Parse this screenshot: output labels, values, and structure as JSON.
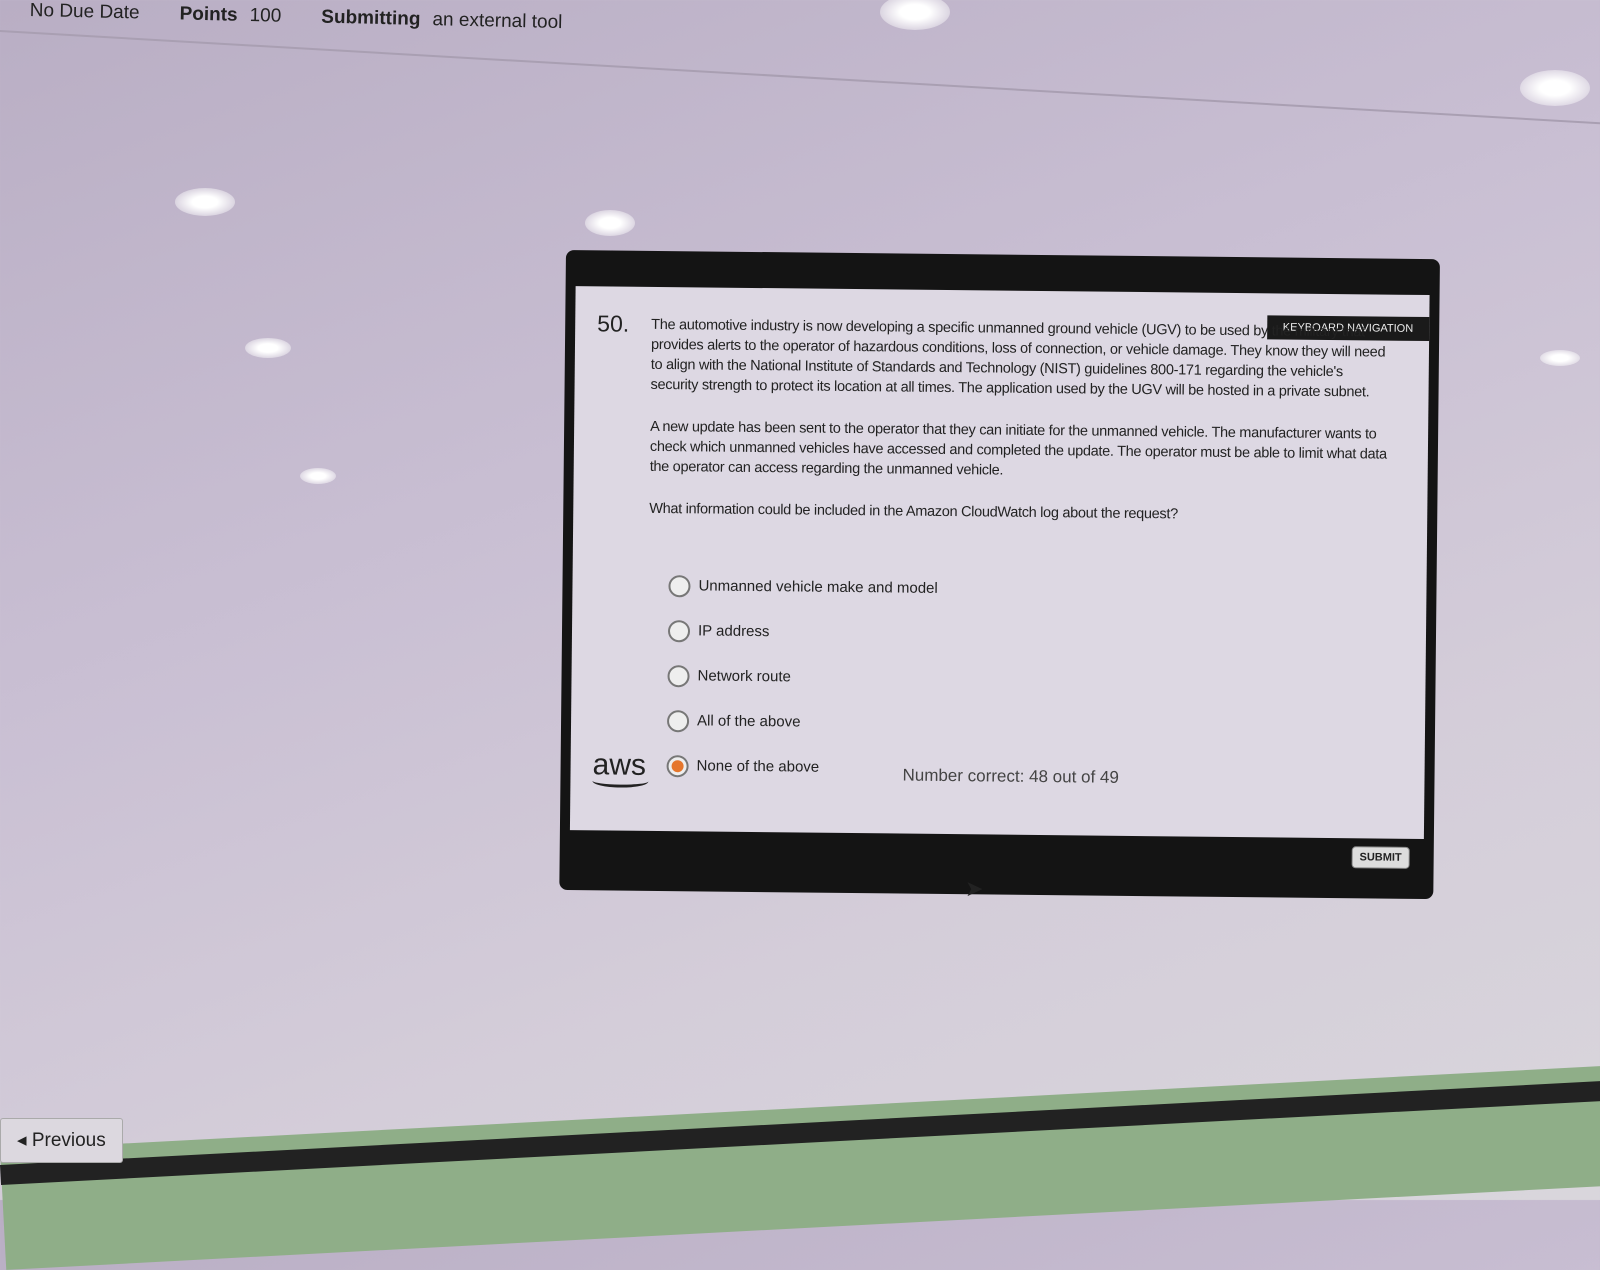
{
  "header": {
    "due_label": "No Due Date",
    "points_label": "Points",
    "points_value": "100",
    "submitting_label": "Submitting",
    "submitting_value": "an external tool"
  },
  "quiz": {
    "keyboard_nav": "KEYBOARD NAVIGATION",
    "number": "50.",
    "paragraphs": [
      "The automotive industry is now developing a specific unmanned ground vehicle (UGV) to be used by the military that provides alerts to the operator of hazardous conditions, loss of connection, or vehicle damage. They know they will need to align with the National Institute of Standards and Technology (NIST) guidelines 800-171 regarding the vehicle's security strength to protect its location at all times. The application used by the UGV will be hosted in a private subnet.",
      "A new update has been sent to the operator that they can initiate for the unmanned vehicle. The manufacturer wants to check which unmanned vehicles have accessed and completed the update. The operator must be able to limit what data the operator can access regarding the unmanned vehicle.",
      "What information could be included in the Amazon CloudWatch log about the request?"
    ],
    "options": [
      {
        "label": "Unmanned vehicle make and model",
        "selected": false
      },
      {
        "label": "IP address",
        "selected": false
      },
      {
        "label": "Network route",
        "selected": false
      },
      {
        "label": "All of the above",
        "selected": false
      },
      {
        "label": "None of the above",
        "selected": true
      }
    ],
    "logo": "aws",
    "score": "Number correct: 48 out of 49",
    "submit_label": "SUBMIT",
    "accent_color": "#e5762c"
  },
  "nav": {
    "previous_label": "Previous"
  }
}
